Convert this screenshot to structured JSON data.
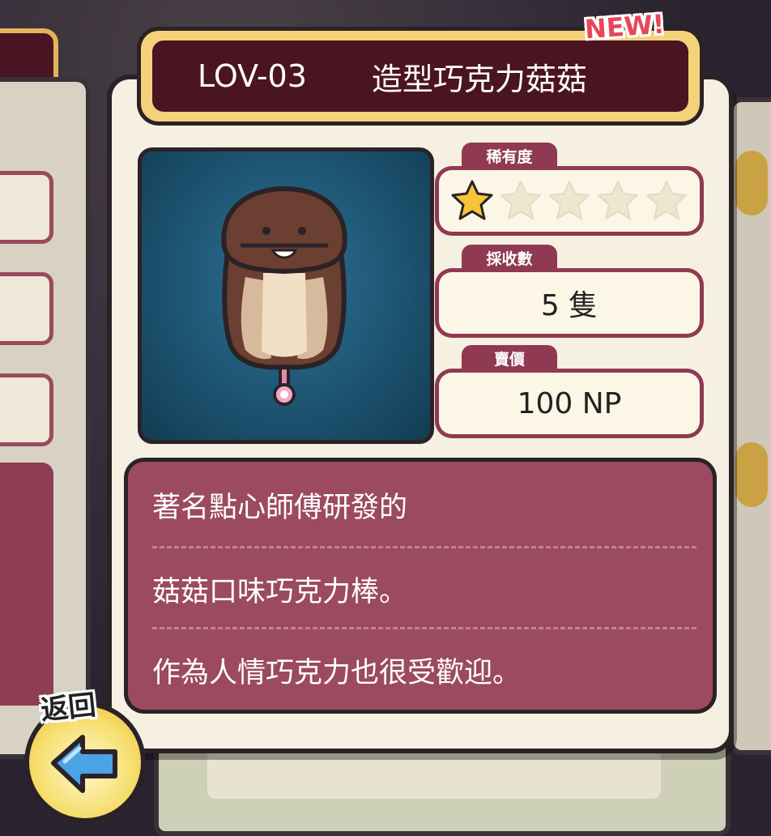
{
  "card": {
    "code": "LOV-03",
    "name": "造型巧克力菇菇",
    "new_badge": "NEW!"
  },
  "stats": {
    "rarity_label": "稀有度",
    "rarity_stars": 1,
    "rarity_max": 5,
    "collected_label": "採收數",
    "collected_value": "5 隻",
    "price_label": "賣價",
    "price_value": "100 NP"
  },
  "description": {
    "lines": [
      "著名點心師傅研發的",
      "菇菇口味巧克力棒。",
      "作為人情巧克力也很受歡迎。"
    ]
  },
  "back_button": {
    "label": "返回"
  },
  "colors": {
    "accent": "#8f3a52",
    "title_bg": "#4b1421",
    "portrait_bg": "#1d5572",
    "star_gold": "#f5c43b"
  }
}
